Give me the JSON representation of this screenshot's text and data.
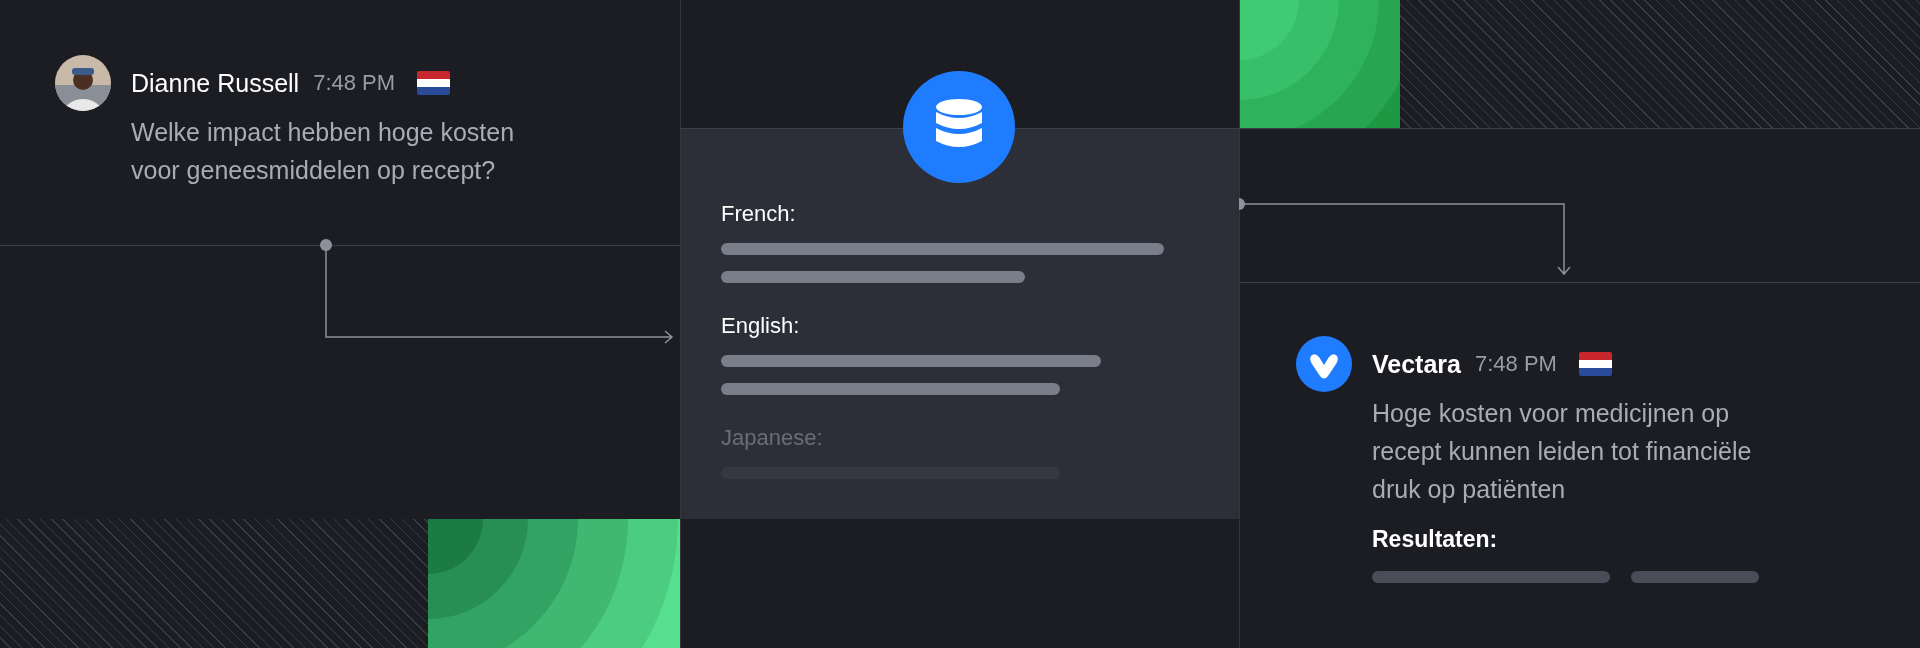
{
  "question": {
    "author": "Dianne Russell",
    "time": "7:48 PM",
    "text": "Welke impact hebben hoge kosten voor geneesmiddelen op recept?"
  },
  "index_card": {
    "sections": [
      {
        "label": "French:",
        "faded": false
      },
      {
        "label": "English:",
        "faded": false
      },
      {
        "label": "Japanese:",
        "faded": true
      }
    ]
  },
  "answer": {
    "author": "Vectara",
    "time": "7:48 PM",
    "text": "Hoge kosten voor medicijnen op recept kunnen leiden tot financiële druk op patiënten",
    "results_label": "Resultaten:"
  }
}
